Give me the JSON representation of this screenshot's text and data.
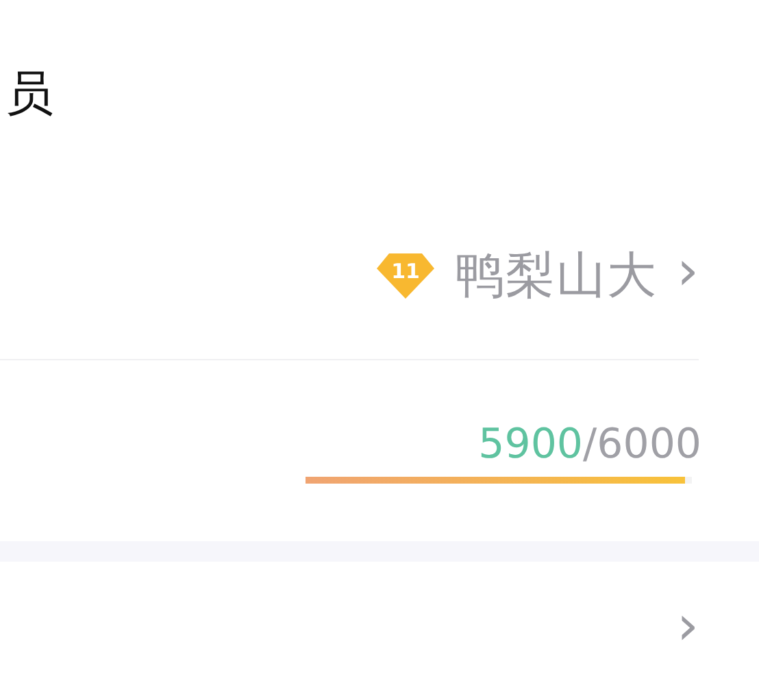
{
  "header": {
    "title": "员"
  },
  "member_row": {
    "badge": "11",
    "name": "鸭梨山大",
    "chevron": "›"
  },
  "progress_row": {
    "current": "5900",
    "separator": "/",
    "total": "6000",
    "level": 0.983
  },
  "next_row": {
    "chevron": "›"
  }
}
